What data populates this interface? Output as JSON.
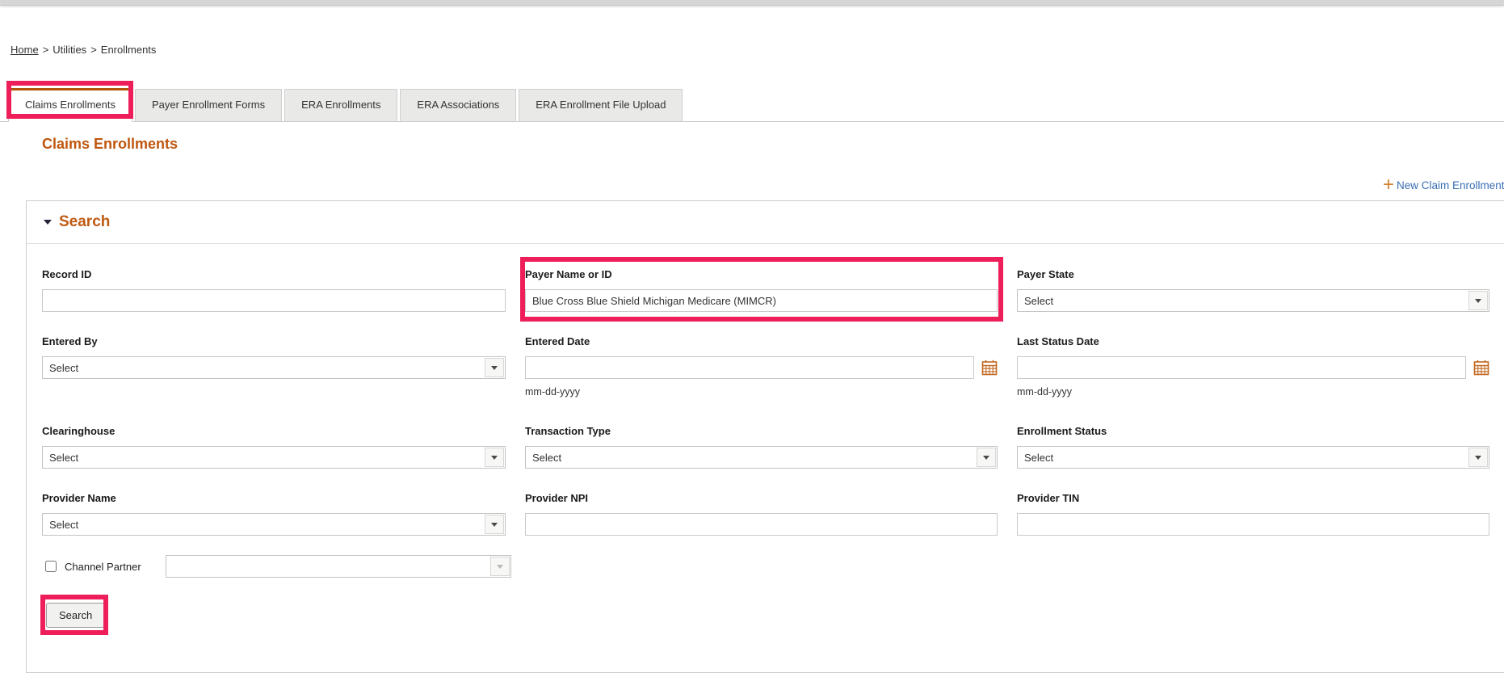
{
  "breadcrumb": {
    "home": "Home",
    "sep1": ">",
    "utilities": "Utilities",
    "sep2": ">",
    "enrollments": "Enrollments"
  },
  "tabs": [
    {
      "label": "Claims Enrollments",
      "active": true
    },
    {
      "label": "Payer Enrollment Forms",
      "active": false
    },
    {
      "label": "ERA Enrollments",
      "active": false
    },
    {
      "label": "ERA Associations",
      "active": false
    },
    {
      "label": "ERA Enrollment File Upload",
      "active": false
    }
  ],
  "page": {
    "title": "Claims Enrollments"
  },
  "actions": {
    "new_claim_enrollment_plus": "+",
    "new_claim_enrollment": "New Claim Enrollment"
  },
  "search_panel": {
    "header": "Search",
    "fields": {
      "record_id": {
        "label": "Record ID",
        "value": ""
      },
      "payer_name_or_id": {
        "label": "Payer Name or ID",
        "value": "Blue Cross Blue Shield Michigan Medicare (MIMCR)"
      },
      "payer_state": {
        "label": "Payer State",
        "value": "Select"
      },
      "entered_by": {
        "label": "Entered By",
        "value": "Select"
      },
      "entered_date": {
        "label": "Entered Date",
        "value": "",
        "hint": "mm-dd-yyyy"
      },
      "last_status_date": {
        "label": "Last Status Date",
        "value": "",
        "hint": "mm-dd-yyyy"
      },
      "clearinghouse": {
        "label": "Clearinghouse",
        "value": "Select"
      },
      "transaction_type": {
        "label": "Transaction Type",
        "value": "Select"
      },
      "enrollment_status": {
        "label": "Enrollment Status",
        "value": "Select"
      },
      "provider_name": {
        "label": "Provider Name",
        "value": "Select"
      },
      "provider_npi": {
        "label": "Provider NPI",
        "value": ""
      },
      "provider_tin": {
        "label": "Provider TIN",
        "value": ""
      },
      "channel_partner": {
        "label": "Channel Partner",
        "checked": false,
        "value": ""
      }
    },
    "search_button": "Search"
  },
  "annotations": {
    "highlight_color": "#ed1e5a",
    "highlighted": [
      "claims-enrollments-tab",
      "payer-name-or-id-field",
      "search-button"
    ]
  },
  "colors": {
    "accent_orange": "#bf560e",
    "tab_active_border": "#b4540a",
    "link_blue": "#3a6fb4",
    "icon_orange": "#c2671f"
  }
}
